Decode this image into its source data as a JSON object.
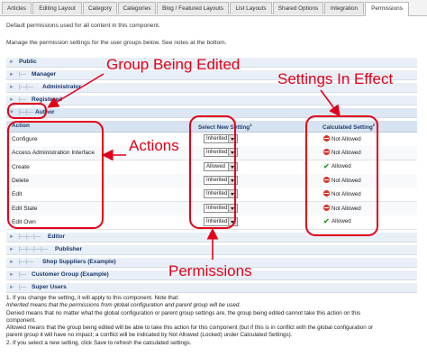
{
  "tabs": [
    "Articles",
    "Editing Layout",
    "Category",
    "Categories",
    "Blog / Featured Layouts",
    "List Layouts",
    "Shared Options",
    "Integration",
    "Permissions"
  ],
  "intro": {
    "line1": "Default permissions used for all content in this component.",
    "line2": "Manage the permission settings for the user groups below. See notes at the bottom."
  },
  "groups_top": [
    {
      "tree": "",
      "name": "Public"
    },
    {
      "tree": "|—",
      "name": "Manager"
    },
    {
      "tree": "|—|—",
      "name": "Administrator"
    },
    {
      "tree": "|—",
      "name": "Registered"
    },
    {
      "tree": "|—|—",
      "name": "Author"
    }
  ],
  "table": {
    "col_action": "Action",
    "col_setting": "Select New Setting",
    "col_setting_sup": "1",
    "col_calc": "Calculated Setting",
    "col_calc_sup": "2",
    "rows": [
      {
        "action": "Configure",
        "setting": "Inherited",
        "calc": "Not Allowed",
        "allowed": false
      },
      {
        "action": "Access Administration Interface",
        "setting": "Inherited",
        "calc": "Not Allowed",
        "allowed": false
      },
      {
        "action": "Create",
        "setting": "Allowed",
        "calc": "Allowed",
        "allowed": true
      },
      {
        "action": "Delete",
        "setting": "Inherited",
        "calc": "Not Allowed",
        "allowed": false
      },
      {
        "action": "Edit",
        "setting": "Inherited",
        "calc": "Not Allowed",
        "allowed": false
      },
      {
        "action": "Edit State",
        "setting": "Inherited",
        "calc": "Not Allowed",
        "allowed": false
      },
      {
        "action": "Edit Own",
        "setting": "Inherited",
        "calc": "Allowed",
        "allowed": true
      }
    ]
  },
  "groups_bottom": [
    {
      "tree": "|—|—|—",
      "name": "Editor"
    },
    {
      "tree": "|—|—|—|—",
      "name": "Publisher"
    },
    {
      "tree": "|—|—",
      "name": "Shop Suppliers (Example)"
    },
    {
      "tree": "|—",
      "name": "Customer Group (Example)"
    },
    {
      "tree": "|—",
      "name": "Super Users"
    }
  ],
  "notes": [
    "1. If you change the setting, it will apply to this component. Note that:",
    "Inherited means that the permissions from global configuration and parent group will be used.",
    "Denied means that no matter what the global configuration or parent group settings are, the group being edited cannot take this action on this",
    "component.",
    "Allowed means that the group being edited will be able to take this action for this component (but if this is in conflict with the global configuration or",
    "parent group it will have no impact; a conflict will be indicated by Not Allowed (Locked) under Calculated Settings).",
    "2. If you select a new setting, click Save to refresh the calculated settings."
  ],
  "annotations": {
    "group": "Group Being Edited",
    "settings": "Settings In Effect",
    "actions": "Actions",
    "permissions": "Permissions"
  },
  "colors": {
    "annotation": "#e2001a",
    "group_row_bg": "#e9eff6",
    "header_bg": "#d7e3f0",
    "allowed": "#2d9a27",
    "not_allowed": "#d9342b"
  }
}
